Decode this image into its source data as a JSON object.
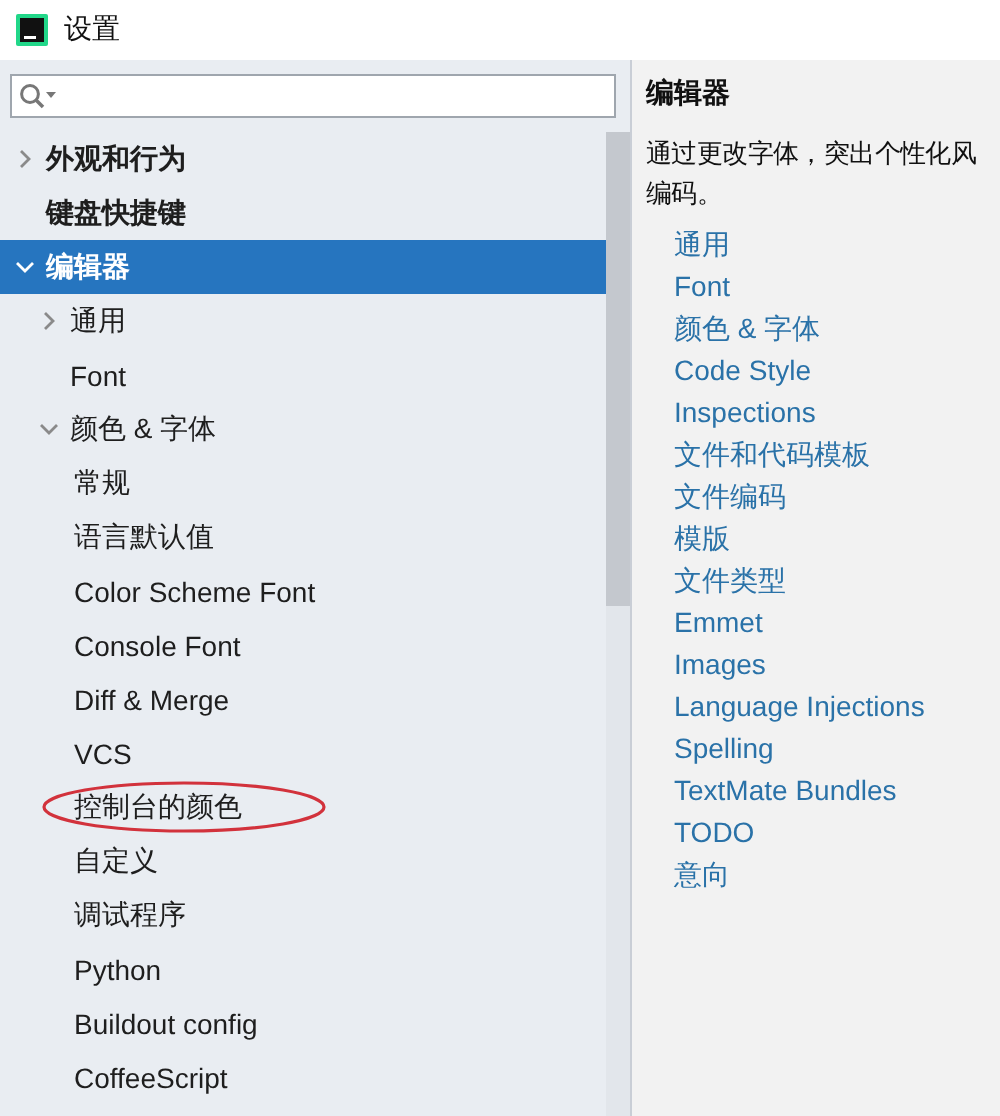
{
  "window": {
    "title": "设置"
  },
  "tree": [
    {
      "label": "外观和行为",
      "expanded": false,
      "selected": false
    },
    {
      "label": "键盘快捷键",
      "selected": false
    },
    {
      "label": "编辑器",
      "expanded": true,
      "selected": true,
      "children": [
        {
          "label": "通用",
          "expanded": false,
          "selected": false
        },
        {
          "label": "Font",
          "selected": false
        },
        {
          "label": "颜色 & 字体",
          "expanded": true,
          "selected": false,
          "children": [
            {
              "label": "常规",
              "selected": false,
              "circled": false
            },
            {
              "label": "语言默认值",
              "selected": false,
              "circled": false
            },
            {
              "label": "Color Scheme Font",
              "selected": false,
              "circled": false
            },
            {
              "label": "Console Font",
              "selected": false,
              "circled": false
            },
            {
              "label": "Diff & Merge",
              "selected": false,
              "circled": false
            },
            {
              "label": "VCS",
              "selected": false,
              "circled": false
            },
            {
              "label": "控制台的颜色",
              "selected": false,
              "circled": true
            },
            {
              "label": "自定义",
              "selected": false,
              "circled": false
            },
            {
              "label": "调试程序",
              "selected": false,
              "circled": false
            },
            {
              "label": "Python",
              "selected": false,
              "circled": false
            },
            {
              "label": "Buildout config",
              "selected": false,
              "circled": false
            },
            {
              "label": "CoffeeScript",
              "selected": false,
              "circled": false
            }
          ]
        }
      ]
    }
  ],
  "detail": {
    "heading": "编辑器",
    "description_lines": [
      "通过更改字体，突出个性化风",
      "编码。"
    ],
    "links": [
      "通用",
      "Font",
      "颜色 & 字体",
      "Code Style",
      "Inspections",
      "文件和代码模板",
      "文件编码",
      "模版",
      "文件类型",
      "Emmet",
      "Images",
      "Language Injections",
      "Spelling",
      "TextMate Bundles",
      "TODO",
      "意向"
    ]
  }
}
